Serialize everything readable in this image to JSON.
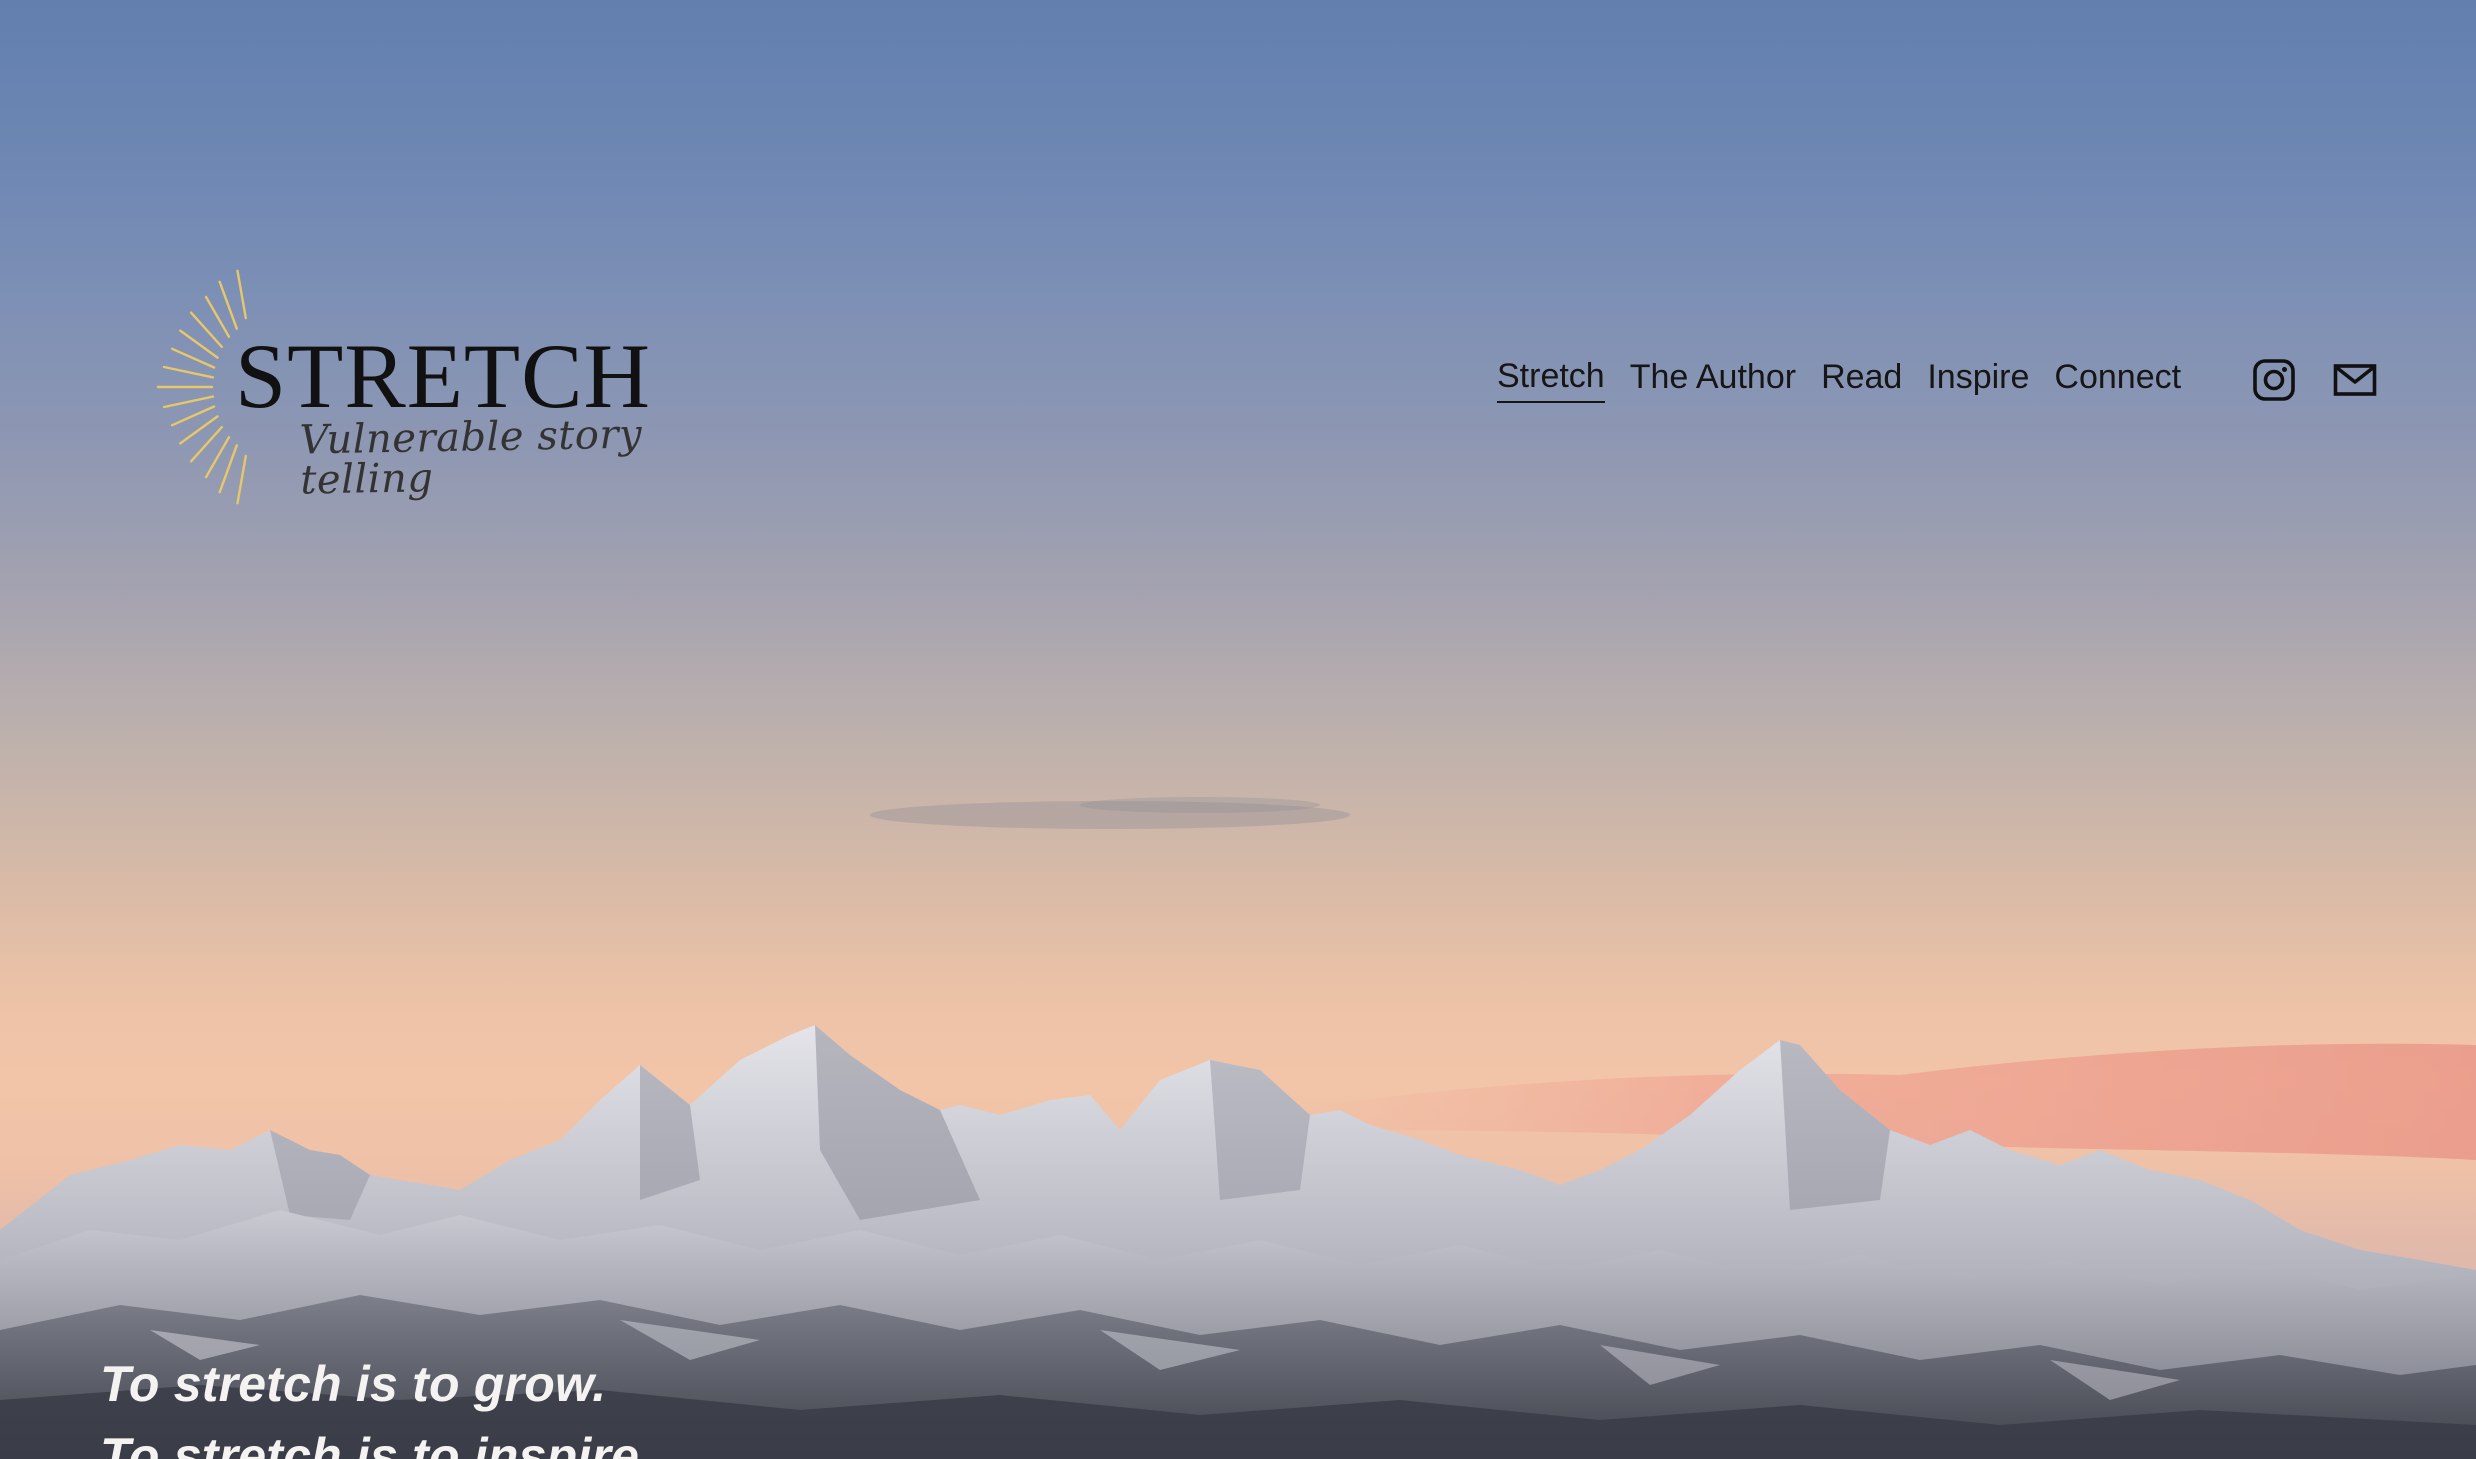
{
  "site": {
    "logo": {
      "title": "STRETCH",
      "subtitle": "Vulnerable story telling",
      "rays_color": "#e6c76a"
    }
  },
  "nav": {
    "items": [
      {
        "label": "Stretch",
        "active": true
      },
      {
        "label": "The Author",
        "active": false
      },
      {
        "label": "Read",
        "active": false
      },
      {
        "label": "Inspire",
        "active": false
      },
      {
        "label": "Connect",
        "active": false
      }
    ]
  },
  "social": {
    "icons": [
      "instagram-icon",
      "mail-icon"
    ]
  },
  "hero": {
    "line1": "To stretch is to grow.",
    "line2": "To stretch is to inspire."
  },
  "colors": {
    "sky_top": "#627fae",
    "sky_horizon": "#f2c5a8",
    "pink_clouds": "#ef9a8a",
    "snow": "#dcdde3",
    "rock": "#5b5d68",
    "text_dark": "#161616",
    "text_light": "#f4f3f2"
  }
}
